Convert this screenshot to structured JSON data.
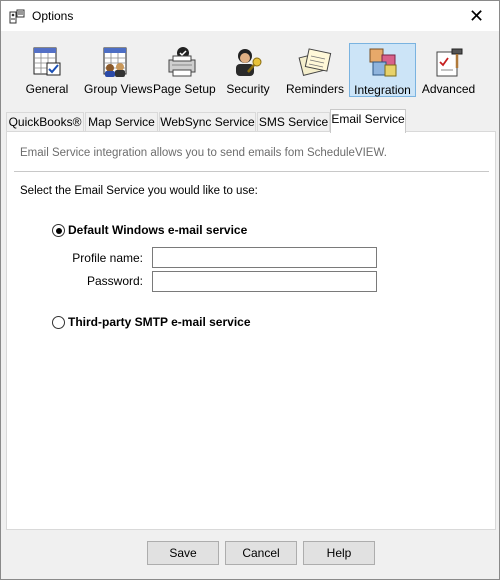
{
  "window": {
    "title": "Options",
    "close_glyph": "✕"
  },
  "toolbar": {
    "buttons": [
      {
        "label": "General",
        "icon": "calendar-check-icon"
      },
      {
        "label": "Group Views",
        "icon": "group-views-icon"
      },
      {
        "label": "Page Setup",
        "icon": "printer-icon"
      },
      {
        "label": "Security",
        "icon": "security-key-icon"
      },
      {
        "label": "Reminders",
        "icon": "reminders-notes-icon"
      },
      {
        "label": "Integration",
        "icon": "integration-cubes-icon",
        "active": true
      },
      {
        "label": "Advanced",
        "icon": "advanced-hammer-icon"
      }
    ]
  },
  "tabs": [
    {
      "label": "QuickBooks®"
    },
    {
      "label": "Map Service"
    },
    {
      "label": "WebSync Service"
    },
    {
      "label": "SMS Service"
    },
    {
      "label": "Email Service",
      "active": true
    }
  ],
  "panel": {
    "intro": "Email Service integration allows you to send emails fom ScheduleVIEW.",
    "select_label": "Select the Email Service you would like to use:",
    "option_default": {
      "label": "Default Windows e-mail service",
      "checked": true
    },
    "profile_label": "Profile name:",
    "profile_value": "",
    "password_label": "Password:",
    "password_value": "",
    "option_smtp": {
      "label": "Third-party SMTP e-mail service",
      "checked": false
    }
  },
  "buttons": {
    "save": "Save",
    "cancel": "Cancel",
    "help": "Help"
  },
  "colors": {
    "active_highlight": "#cce4f7",
    "active_border": "#7ab3e0",
    "window_bg": "#f0f0f0"
  }
}
